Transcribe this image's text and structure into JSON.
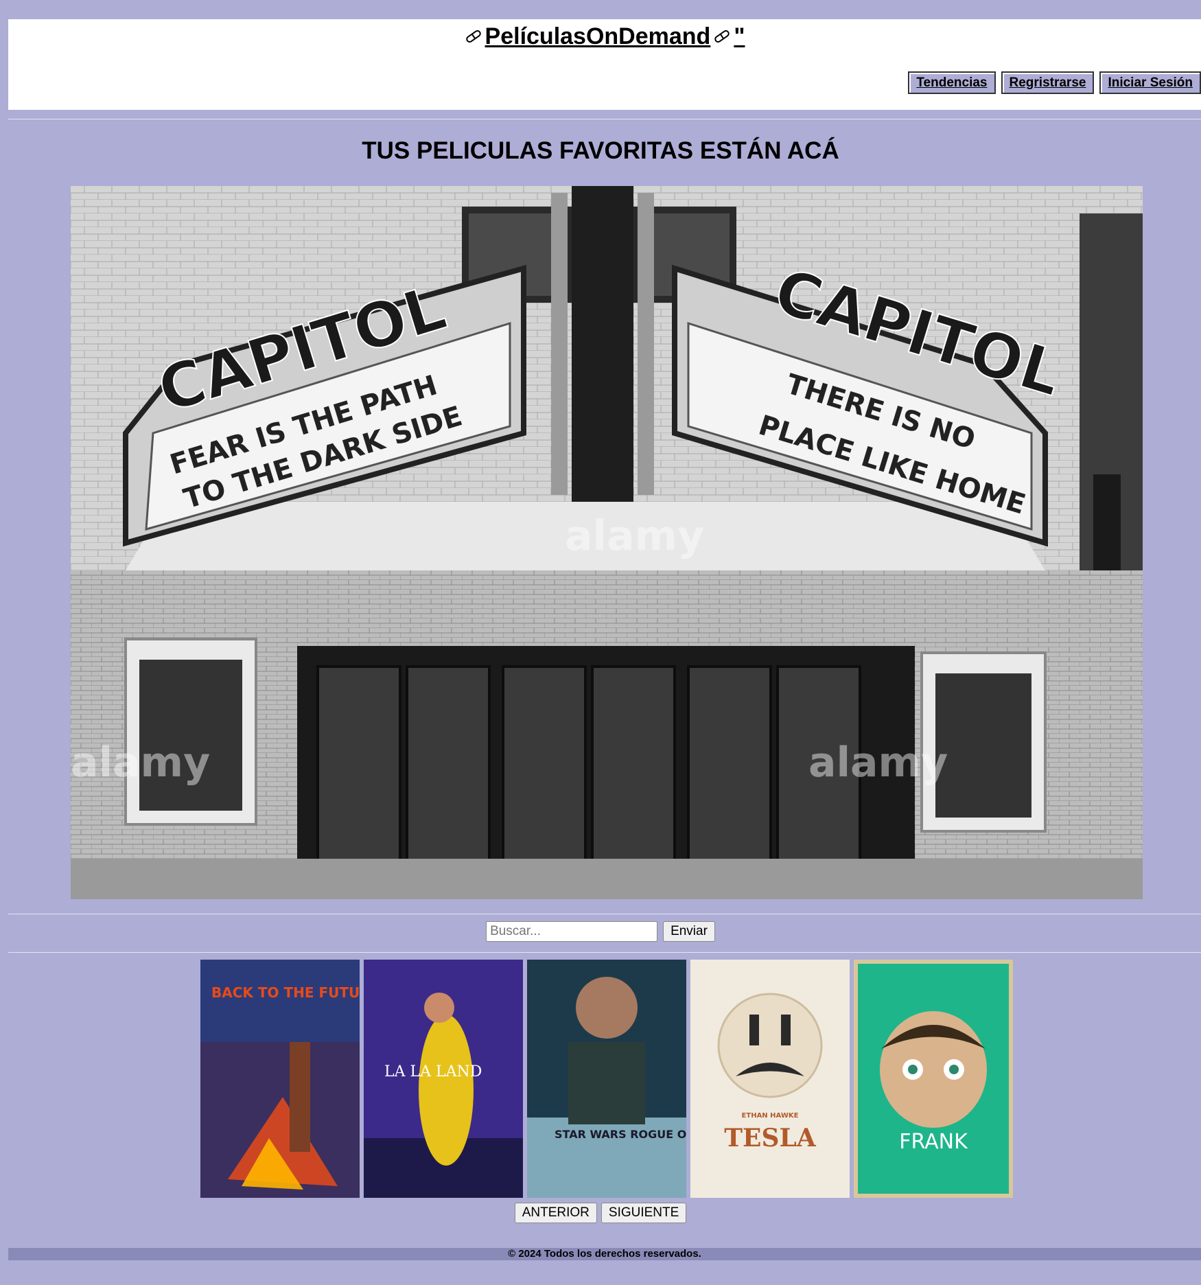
{
  "header": {
    "brand": "PelículasOnDemand",
    "brand_suffix": "\"",
    "nav": [
      "Tendencias",
      "Regristrarse",
      "Iniciar Sesión"
    ]
  },
  "main": {
    "headline": "TUS PELICULAS FAVORITAS ESTÁN ACÁ",
    "hero": {
      "marquee_left_sign": "CAPITOL",
      "marquee_left_line1": "FEAR IS THE PATH",
      "marquee_left_line2": "TO THE DARK SIDE",
      "marquee_right_sign": "CAPITOL",
      "marquee_right_line1": "THERE IS NO",
      "marquee_right_line2": "PLACE LIKE HOME",
      "watermark": "alamy"
    }
  },
  "search": {
    "placeholder": "Buscar...",
    "submit_label": "Enviar"
  },
  "posters": [
    {
      "title": "BACK TO THE FUTURE",
      "bg": "#2b3b7a",
      "accent": "#e84a1a"
    },
    {
      "title": "LA LA LAND",
      "bg": "#3b2a8a",
      "accent": "#e6c21a"
    },
    {
      "title": "STAR WARS ROGUE ONE",
      "bg": "#1d3a4a",
      "accent": "#c9d6dc"
    },
    {
      "title": "TESLA",
      "subtitle": "ETHAN HAWKE",
      "bg": "#f1ebdf",
      "accent": "#b25a2a"
    },
    {
      "title": "FRANK",
      "bg": "#1fb58a",
      "accent": "#d9b38c"
    }
  ],
  "pager": {
    "prev_label": "ANTERIOR",
    "next_label": "SIGUIENTE"
  },
  "footer": {
    "copyright": "© 2024 Todos los derechos reservados."
  }
}
